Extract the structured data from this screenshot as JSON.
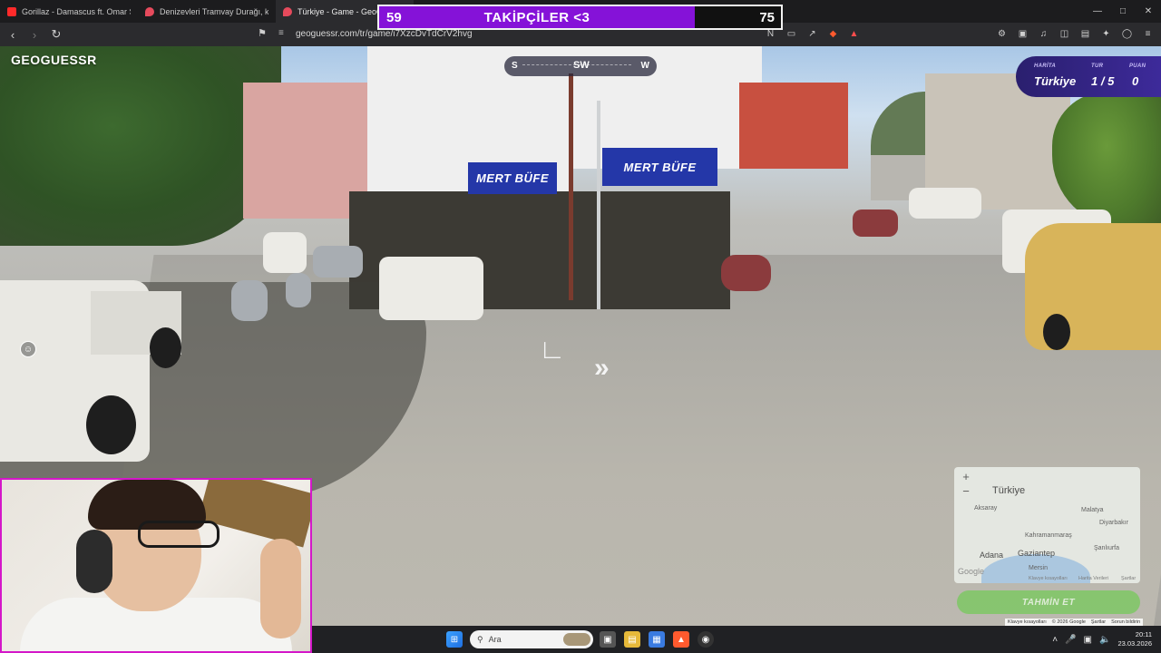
{
  "browser": {
    "tabs": [
      {
        "title": "Gorillaz - Damascus ft. Omar Souleyman",
        "favicon_color": "#ff2a2a"
      },
      {
        "title": "Denizevleri Tramvay Durağı, kargo fi",
        "favicon_color": "#e64a5c"
      },
      {
        "title": "Türkiye - Game - GeoGuessr",
        "favicon_color": "#e64a5c"
      }
    ],
    "url": "geoguessr.com/tr/game/i7XzcDvTdCrV2hvg"
  },
  "follower_goal": {
    "current": "59",
    "title": "TAKİPÇİLER <3",
    "target": "75",
    "fill_color": "#8512d8"
  },
  "game": {
    "logo": "GEOGUESSR",
    "compass": {
      "left": "S",
      "center": "SW",
      "right": "W"
    },
    "status": {
      "map_label": "HARİTA",
      "map_value": "Türkiye",
      "round_label": "TUR",
      "round_value": "1 / 5",
      "score_label": "PUAN",
      "score_value": "0"
    },
    "signs": [
      "MERT BÜFE",
      "MERT BÜFE"
    ],
    "minimap": {
      "country": "Türkiye",
      "cities": [
        "Aksaray",
        "Malatya",
        "Diyarbakır",
        "Kahramanmaraş",
        "Adana",
        "Gaziantep",
        "Şanlıurfa",
        "Mersin"
      ],
      "google": "Google",
      "footer": [
        "Klavye kısayolları",
        "Harita Verileri",
        "Şartlar"
      ]
    },
    "guess_button": "TAHMİN ET",
    "map_footer": [
      "Klavye kısayolları",
      "© 2026 Google",
      "Şartlar",
      "Sorun bildirin"
    ]
  },
  "taskbar": {
    "search_placeholder": "Ara",
    "time": "20:11",
    "date": "23.03.2026"
  }
}
